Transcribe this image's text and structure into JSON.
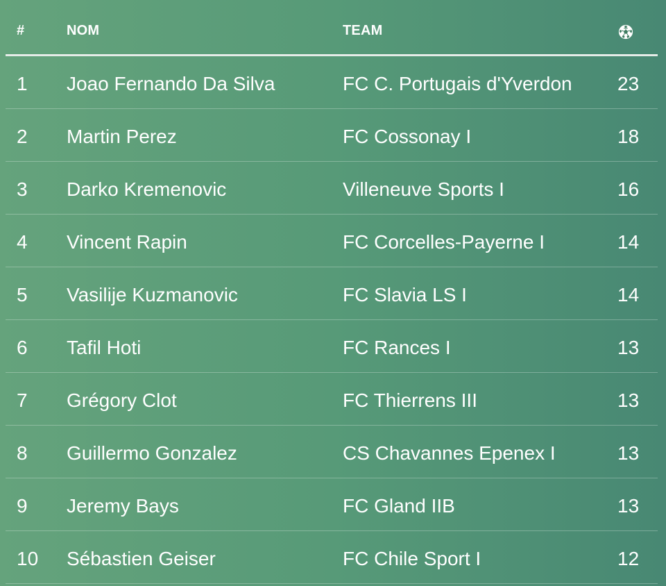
{
  "table": {
    "headers": {
      "rank": "#",
      "name": "NOM",
      "team": "TEAM",
      "goals_icon": "soccer-ball-icon"
    },
    "rows": [
      {
        "rank": "1",
        "name": "Joao Fernando Da Silva",
        "team": "FC C. Portugais d'Yverdon",
        "goals": "23"
      },
      {
        "rank": "2",
        "name": "Martin Perez",
        "team": "FC Cossonay I",
        "goals": "18"
      },
      {
        "rank": "3",
        "name": "Darko Kremenovic",
        "team": "Villeneuve Sports I",
        "goals": "16"
      },
      {
        "rank": "4",
        "name": "Vincent Rapin",
        "team": "FC Corcelles-Payerne I",
        "goals": "14"
      },
      {
        "rank": "5",
        "name": "Vasilije Kuzmanovic",
        "team": "FC Slavia LS I",
        "goals": "14"
      },
      {
        "rank": "6",
        "name": "Tafil Hoti",
        "team": "FC Rances I",
        "goals": "13"
      },
      {
        "rank": "7",
        "name": "Grégory Clot",
        "team": "FC Thierrens III",
        "goals": "13"
      },
      {
        "rank": "8",
        "name": "Guillermo Gonzalez",
        "team": "CS Chavannes Epenex I",
        "goals": "13"
      },
      {
        "rank": "9",
        "name": "Jeremy Bays",
        "team": "FC Gland IIB",
        "goals": "13"
      },
      {
        "rank": "10",
        "name": "Sébastien Geiser",
        "team": "FC Chile Sport I",
        "goals": "12"
      }
    ]
  }
}
